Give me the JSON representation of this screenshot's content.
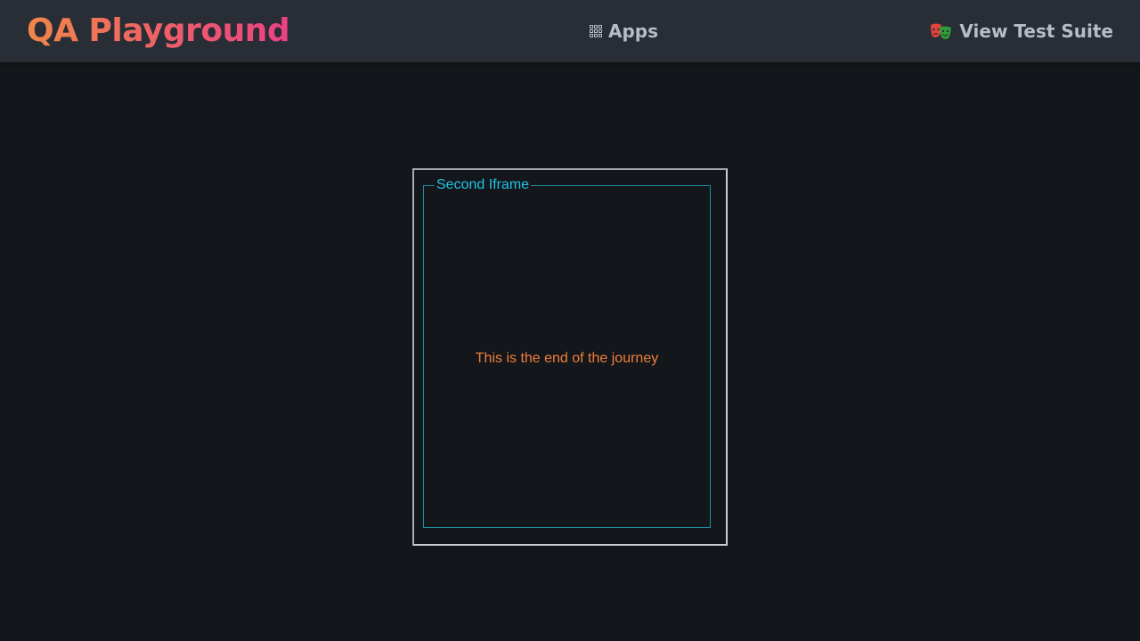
{
  "header": {
    "logo_text": "QA Playground",
    "nav_apps_label": "Apps",
    "nav_apps_icon": "grid-icon",
    "nav_suite_label": "View Test Suite",
    "nav_suite_icon": "theater-masks-icon"
  },
  "iframe": {
    "legend": "Second Iframe",
    "message": "This is the end of the journey"
  },
  "colors": {
    "background": "#13171b",
    "header_background": "#292d35",
    "logo_gradient_start": "#f0874a",
    "logo_gradient_end": "#ec4185",
    "nav_text": "#b7bcc6",
    "legend": "#21c3e6",
    "fieldset_border": "#1f8e9e",
    "message": "#f27f3b"
  }
}
